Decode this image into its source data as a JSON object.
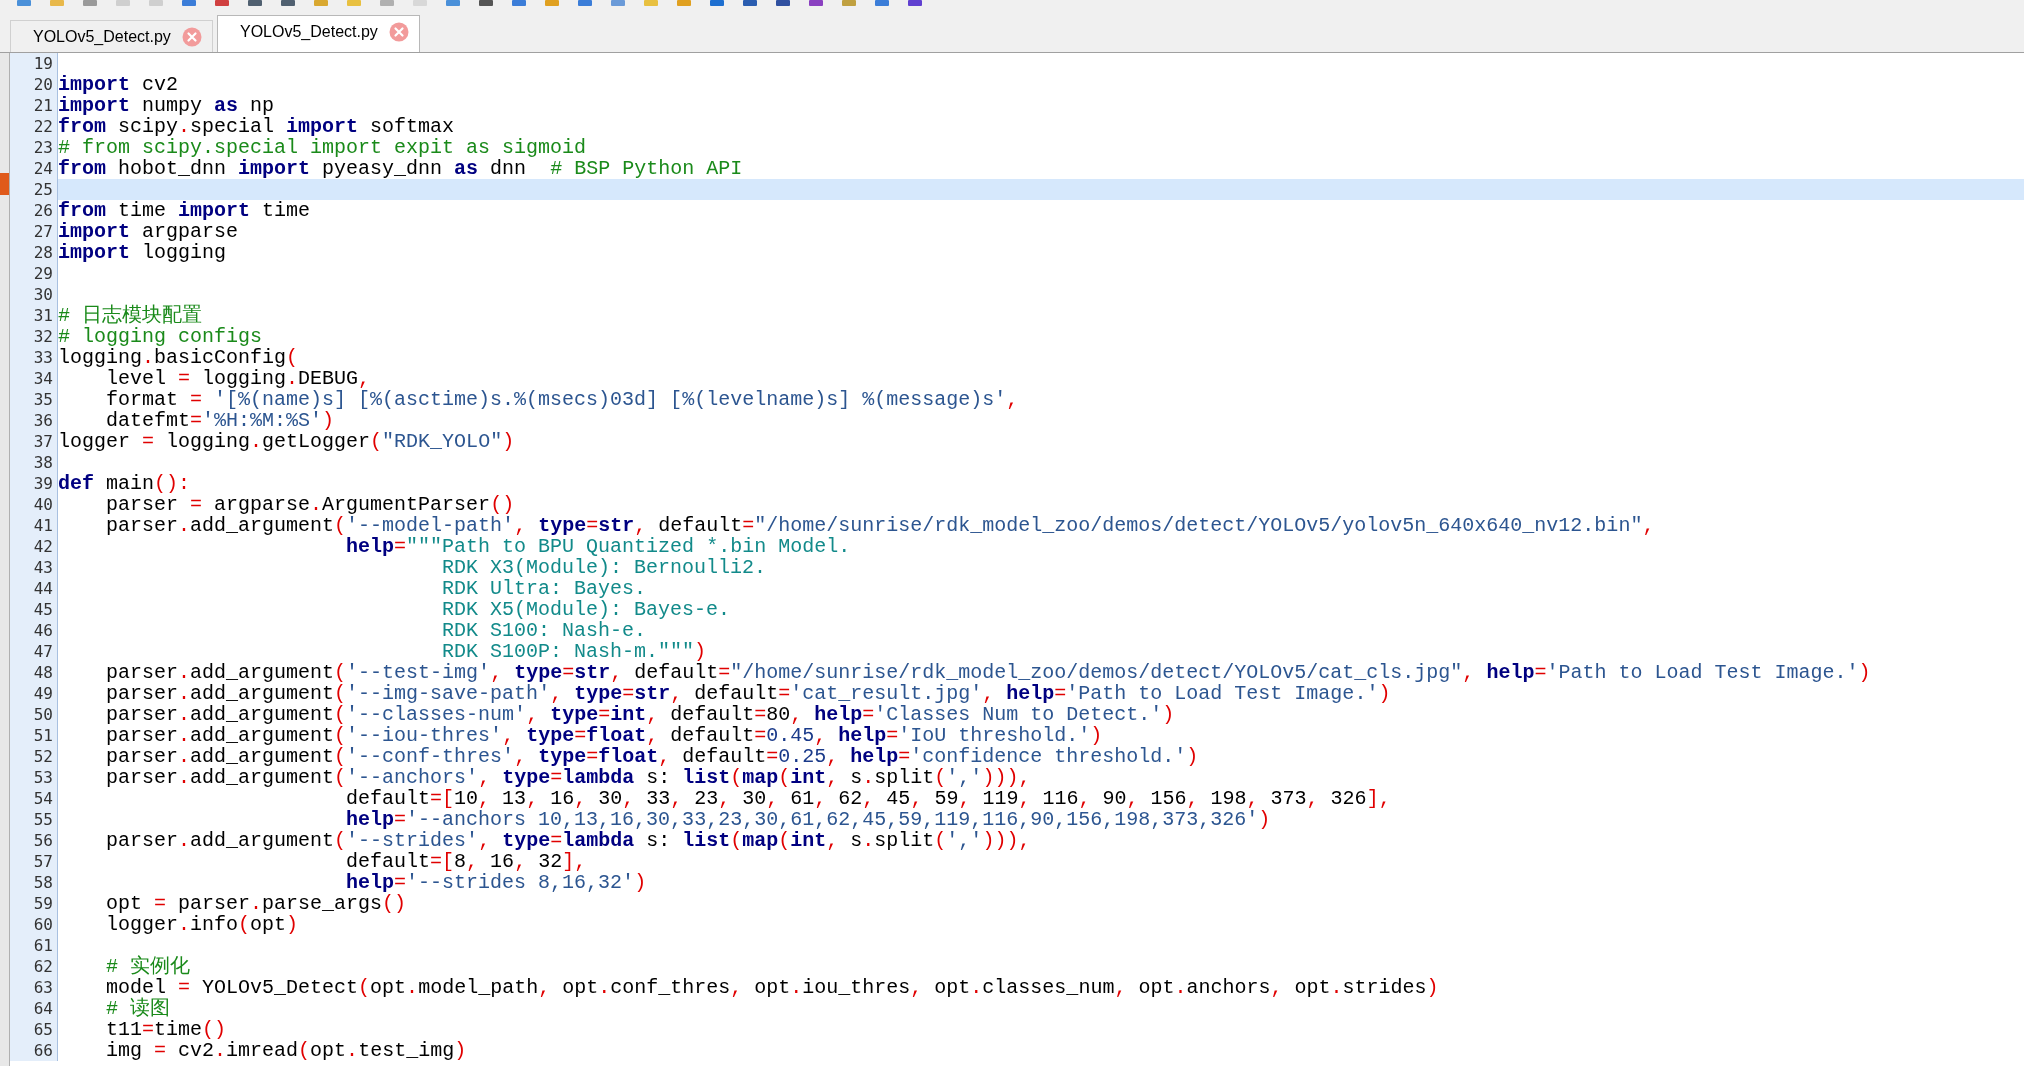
{
  "tabs": [
    {
      "label": "YOLOv5_Detect.py",
      "selected": false
    },
    {
      "label": "YOLOv5_Detect.py",
      "selected": true
    }
  ],
  "lines": [
    {
      "number": "19",
      "current": false
    },
    {
      "number": "20",
      "current": false,
      "tokens": [
        {
          "kind": "keyword",
          "text": "import"
        },
        {
          "kind": "plain",
          "text": " cv2"
        }
      ]
    },
    {
      "number": "21",
      "current": false,
      "tokens": [
        {
          "kind": "keyword",
          "text": "import"
        },
        {
          "kind": "plain",
          "text": " numpy "
        },
        {
          "kind": "keyword",
          "text": "as"
        },
        {
          "kind": "plain",
          "text": " np"
        }
      ]
    },
    {
      "number": "22",
      "current": false,
      "tokens": [
        {
          "kind": "keyword",
          "text": "from"
        },
        {
          "kind": "plain",
          "text": " scipy"
        },
        {
          "kind": "operator",
          "text": "."
        },
        {
          "kind": "plain",
          "text": "special "
        },
        {
          "kind": "keyword",
          "text": "import"
        },
        {
          "kind": "plain",
          "text": " softmax"
        }
      ]
    },
    {
      "number": "23",
      "current": false,
      "tokens": [
        {
          "kind": "comment",
          "text": "# from scipy.special import expit as sigmoid"
        }
      ]
    },
    {
      "number": "24",
      "current": false,
      "tokens": [
        {
          "kind": "keyword",
          "text": "from"
        },
        {
          "kind": "plain",
          "text": " hobot_dnn "
        },
        {
          "kind": "keyword",
          "text": "import"
        },
        {
          "kind": "plain",
          "text": " pyeasy_dnn "
        },
        {
          "kind": "keyword",
          "text": "as"
        },
        {
          "kind": "plain",
          "text": " dnn"
        },
        {
          "kind": "comment",
          "text": "  # BSP Python API"
        }
      ]
    },
    {
      "number": "25",
      "current": true
    },
    {
      "number": "26",
      "current": false,
      "tokens": [
        {
          "kind": "keyword",
          "text": "from"
        },
        {
          "kind": "plain",
          "text": " time "
        },
        {
          "kind": "keyword",
          "text": "import"
        },
        {
          "kind": "plain",
          "text": " time"
        }
      ]
    },
    {
      "number": "27",
      "current": false,
      "tokens": [
        {
          "kind": "keyword",
          "text": "import"
        },
        {
          "kind": "plain",
          "text": " argparse"
        }
      ]
    },
    {
      "number": "28",
      "current": false,
      "tokens": [
        {
          "kind": "keyword",
          "text": "import"
        },
        {
          "kind": "plain",
          "text": " logging"
        }
      ]
    },
    {
      "number": "29",
      "current": false
    },
    {
      "number": "30",
      "current": false
    },
    {
      "number": "31",
      "current": false,
      "tokens": [
        {
          "kind": "comment",
          "text": "# 日志模块配置"
        }
      ]
    },
    {
      "number": "32",
      "current": false,
      "tokens": [
        {
          "kind": "comment",
          "text": "# logging configs"
        }
      ]
    },
    {
      "number": "33",
      "current": false,
      "tokens": [
        {
          "kind": "plain",
          "text": "logging"
        },
        {
          "kind": "operator",
          "text": "."
        },
        {
          "kind": "plain",
          "text": "basicConfig"
        },
        {
          "kind": "operator",
          "text": "("
        }
      ]
    },
    {
      "number": "34",
      "current": false,
      "tokens": [
        {
          "kind": "plain",
          "text": "    level "
        },
        {
          "kind": "operator",
          "text": "="
        },
        {
          "kind": "plain",
          "text": " logging"
        },
        {
          "kind": "operator",
          "text": "."
        },
        {
          "kind": "plain",
          "text": "DEBUG"
        },
        {
          "kind": "operator",
          "text": ","
        }
      ]
    },
    {
      "number": "35",
      "current": false,
      "tokens": [
        {
          "kind": "plain",
          "text": "    format "
        },
        {
          "kind": "operator",
          "text": "="
        },
        {
          "kind": "string",
          "text": " '[%(name)s] [%(asctime)s.%(msecs)03d] [%(levelname)s] %(message)s'"
        },
        {
          "kind": "operator",
          "text": ","
        }
      ]
    },
    {
      "number": "36",
      "current": false,
      "tokens": [
        {
          "kind": "plain",
          "text": "    datefmt"
        },
        {
          "kind": "operator",
          "text": "="
        },
        {
          "kind": "string",
          "text": "'%H:%M:%S'"
        },
        {
          "kind": "operator",
          "text": ")"
        }
      ]
    },
    {
      "number": "37",
      "current": false,
      "tokens": [
        {
          "kind": "plain",
          "text": "logger "
        },
        {
          "kind": "operator",
          "text": "="
        },
        {
          "kind": "plain",
          "text": " logging"
        },
        {
          "kind": "operator",
          "text": "."
        },
        {
          "kind": "plain",
          "text": "getLogger"
        },
        {
          "kind": "operator",
          "text": "("
        },
        {
          "kind": "string",
          "text": "\"RDK_YOLO\""
        },
        {
          "kind": "operator",
          "text": ")"
        }
      ]
    },
    {
      "number": "38",
      "current": false
    },
    {
      "number": "39",
      "current": false,
      "tokens": [
        {
          "kind": "keyword",
          "text": "def"
        },
        {
          "kind": "plain",
          "text": " main"
        },
        {
          "kind": "operator",
          "text": "():"
        }
      ]
    },
    {
      "number": "40",
      "current": false,
      "tokens": [
        {
          "kind": "plain",
          "text": "    parser "
        },
        {
          "kind": "operator",
          "text": "="
        },
        {
          "kind": "plain",
          "text": " argparse"
        },
        {
          "kind": "operator",
          "text": "."
        },
        {
          "kind": "plain",
          "text": "ArgumentParser"
        },
        {
          "kind": "operator",
          "text": "()"
        }
      ]
    },
    {
      "number": "41",
      "current": false,
      "tokens": [
        {
          "kind": "plain",
          "text": "    parser"
        },
        {
          "kind": "operator",
          "text": "."
        },
        {
          "kind": "plain",
          "text": "add_argument"
        },
        {
          "kind": "operator",
          "text": "("
        },
        {
          "kind": "string",
          "text": "'--model-path'"
        },
        {
          "kind": "operator",
          "text": ","
        },
        {
          "kind": "keyword",
          "text": " type"
        },
        {
          "kind": "operator",
          "text": "="
        },
        {
          "kind": "keyword",
          "text": "str"
        },
        {
          "kind": "operator",
          "text": ","
        },
        {
          "kind": "plain",
          "text": " default"
        },
        {
          "kind": "operator",
          "text": "="
        },
        {
          "kind": "string",
          "text": "\"/home/sunrise/rdk_model_zoo/demos/detect/YOLOv5/yolov5n_640x640_nv12.bin\""
        },
        {
          "kind": "operator",
          "text": ","
        }
      ]
    },
    {
      "number": "42",
      "current": false,
      "tokens": [
        {
          "kind": "keyword",
          "text": "                        help"
        },
        {
          "kind": "operator",
          "text": "="
        },
        {
          "kind": "docstring",
          "text": "\"\"\"Path to BPU Quantized *.bin Model."
        }
      ]
    },
    {
      "number": "43",
      "current": false,
      "tokens": [
        {
          "kind": "docstring",
          "text": "                                RDK X3(Module): Bernoulli2."
        }
      ]
    },
    {
      "number": "44",
      "current": false,
      "tokens": [
        {
          "kind": "docstring",
          "text": "                                RDK Ultra: Bayes."
        }
      ]
    },
    {
      "number": "45",
      "current": false,
      "tokens": [
        {
          "kind": "docstring",
          "text": "                                RDK X5(Module): Bayes-e."
        }
      ]
    },
    {
      "number": "46",
      "current": false,
      "tokens": [
        {
          "kind": "docstring",
          "text": "                                RDK S100: Nash-e."
        }
      ]
    },
    {
      "number": "47",
      "current": false,
      "tokens": [
        {
          "kind": "docstring",
          "text": "                                RDK S100P: Nash-m.\"\"\""
        },
        {
          "kind": "operator",
          "text": ")"
        }
      ]
    },
    {
      "number": "48",
      "current": false,
      "tokens": [
        {
          "kind": "plain",
          "text": "    parser"
        },
        {
          "kind": "operator",
          "text": "."
        },
        {
          "kind": "plain",
          "text": "add_argument"
        },
        {
          "kind": "operator",
          "text": "("
        },
        {
          "kind": "string",
          "text": "'--test-img'"
        },
        {
          "kind": "operator",
          "text": ","
        },
        {
          "kind": "keyword",
          "text": " type"
        },
        {
          "kind": "operator",
          "text": "="
        },
        {
          "kind": "keyword",
          "text": "str"
        },
        {
          "kind": "operator",
          "text": ","
        },
        {
          "kind": "plain",
          "text": " default"
        },
        {
          "kind": "operator",
          "text": "="
        },
        {
          "kind": "string",
          "text": "\"/home/sunrise/rdk_model_zoo/demos/detect/YOLOv5/cat_cls.jpg\""
        },
        {
          "kind": "operator",
          "text": ","
        },
        {
          "kind": "keyword",
          "text": " help"
        },
        {
          "kind": "operator",
          "text": "="
        },
        {
          "kind": "string",
          "text": "'Path to Load Test Image.'"
        },
        {
          "kind": "operator",
          "text": ")"
        }
      ]
    },
    {
      "number": "49",
      "current": false,
      "tokens": [
        {
          "kind": "plain",
          "text": "    parser"
        },
        {
          "kind": "operator",
          "text": "."
        },
        {
          "kind": "plain",
          "text": "add_argument"
        },
        {
          "kind": "operator",
          "text": "("
        },
        {
          "kind": "string",
          "text": "'--img-save-path'"
        },
        {
          "kind": "operator",
          "text": ","
        },
        {
          "kind": "keyword",
          "text": " type"
        },
        {
          "kind": "operator",
          "text": "="
        },
        {
          "kind": "keyword",
          "text": "str"
        },
        {
          "kind": "operator",
          "text": ","
        },
        {
          "kind": "plain",
          "text": " default"
        },
        {
          "kind": "operator",
          "text": "="
        },
        {
          "kind": "string",
          "text": "'cat_result.jpg'"
        },
        {
          "kind": "operator",
          "text": ","
        },
        {
          "kind": "keyword",
          "text": " help"
        },
        {
          "kind": "operator",
          "text": "="
        },
        {
          "kind": "string",
          "text": "'Path to Load Test Image.'"
        },
        {
          "kind": "operator",
          "text": ")"
        }
      ]
    },
    {
      "number": "50",
      "current": false,
      "tokens": [
        {
          "kind": "plain",
          "text": "    parser"
        },
        {
          "kind": "operator",
          "text": "."
        },
        {
          "kind": "plain",
          "text": "add_argument"
        },
        {
          "kind": "operator",
          "text": "("
        },
        {
          "kind": "string",
          "text": "'--classes-num'"
        },
        {
          "kind": "operator",
          "text": ","
        },
        {
          "kind": "keyword",
          "text": " type"
        },
        {
          "kind": "operator",
          "text": "="
        },
        {
          "kind": "keyword",
          "text": "int"
        },
        {
          "kind": "operator",
          "text": ","
        },
        {
          "kind": "plain",
          "text": " default"
        },
        {
          "kind": "operator",
          "text": "="
        },
        {
          "kind": "plain",
          "text": "80"
        },
        {
          "kind": "operator",
          "text": ","
        },
        {
          "kind": "keyword",
          "text": " help"
        },
        {
          "kind": "operator",
          "text": "="
        },
        {
          "kind": "string",
          "text": "'Classes Num to Detect.'"
        },
        {
          "kind": "operator",
          "text": ")"
        }
      ]
    },
    {
      "number": "51",
      "current": false,
      "tokens": [
        {
          "kind": "plain",
          "text": "    parser"
        },
        {
          "kind": "operator",
          "text": "."
        },
        {
          "kind": "plain",
          "text": "add_argument"
        },
        {
          "kind": "operator",
          "text": "("
        },
        {
          "kind": "string",
          "text": "'--iou-thres'"
        },
        {
          "kind": "operator",
          "text": ","
        },
        {
          "kind": "keyword",
          "text": " type"
        },
        {
          "kind": "operator",
          "text": "="
        },
        {
          "kind": "keyword",
          "text": "float"
        },
        {
          "kind": "operator",
          "text": ","
        },
        {
          "kind": "plain",
          "text": " default"
        },
        {
          "kind": "operator",
          "text": "="
        },
        {
          "kind": "number",
          "text": "0.45"
        },
        {
          "kind": "operator",
          "text": ","
        },
        {
          "kind": "keyword",
          "text": " help"
        },
        {
          "kind": "operator",
          "text": "="
        },
        {
          "kind": "string",
          "text": "'IoU threshold.'"
        },
        {
          "kind": "operator",
          "text": ")"
        }
      ]
    },
    {
      "number": "52",
      "current": false,
      "tokens": [
        {
          "kind": "plain",
          "text": "    parser"
        },
        {
          "kind": "operator",
          "text": "."
        },
        {
          "kind": "plain",
          "text": "add_argument"
        },
        {
          "kind": "operator",
          "text": "("
        },
        {
          "kind": "string",
          "text": "'--conf-thres'"
        },
        {
          "kind": "operator",
          "text": ","
        },
        {
          "kind": "keyword",
          "text": " type"
        },
        {
          "kind": "operator",
          "text": "="
        },
        {
          "kind": "keyword",
          "text": "float"
        },
        {
          "kind": "operator",
          "text": ","
        },
        {
          "kind": "plain",
          "text": " default"
        },
        {
          "kind": "operator",
          "text": "="
        },
        {
          "kind": "number",
          "text": "0.25"
        },
        {
          "kind": "operator",
          "text": ","
        },
        {
          "kind": "keyword",
          "text": " help"
        },
        {
          "kind": "operator",
          "text": "="
        },
        {
          "kind": "string",
          "text": "'confidence threshold.'"
        },
        {
          "kind": "operator",
          "text": ")"
        }
      ]
    },
    {
      "number": "53",
      "current": false,
      "tokens": [
        {
          "kind": "plain",
          "text": "    parser"
        },
        {
          "kind": "operator",
          "text": "."
        },
        {
          "kind": "plain",
          "text": "add_argument"
        },
        {
          "kind": "operator",
          "text": "("
        },
        {
          "kind": "string",
          "text": "'--anchors'"
        },
        {
          "kind": "operator",
          "text": ","
        },
        {
          "kind": "keyword",
          "text": " type"
        },
        {
          "kind": "operator",
          "text": "="
        },
        {
          "kind": "keyword",
          "text": "lambda"
        },
        {
          "kind": "plain",
          "text": " s:"
        },
        {
          "kind": "keyword",
          "text": " list"
        },
        {
          "kind": "operator",
          "text": "("
        },
        {
          "kind": "keyword",
          "text": "map"
        },
        {
          "kind": "operator",
          "text": "("
        },
        {
          "kind": "keyword",
          "text": "int"
        },
        {
          "kind": "operator",
          "text": ","
        },
        {
          "kind": "plain",
          "text": " s"
        },
        {
          "kind": "operator",
          "text": "."
        },
        {
          "kind": "plain",
          "text": "split"
        },
        {
          "kind": "operator",
          "text": "("
        },
        {
          "kind": "string",
          "text": "','"
        },
        {
          "kind": "operator",
          "text": "))),"
        }
      ]
    },
    {
      "number": "54",
      "current": false,
      "tokens": [
        {
          "kind": "plain",
          "text": "                        default"
        },
        {
          "kind": "operator",
          "text": "=["
        },
        {
          "kind": "plain",
          "text": "10"
        },
        {
          "kind": "operator",
          "text": ","
        },
        {
          "kind": "plain",
          "text": " 13"
        },
        {
          "kind": "operator",
          "text": ","
        },
        {
          "kind": "plain",
          "text": " 16"
        },
        {
          "kind": "operator",
          "text": ","
        },
        {
          "kind": "plain",
          "text": " 30"
        },
        {
          "kind": "operator",
          "text": ","
        },
        {
          "kind": "plain",
          "text": " 33"
        },
        {
          "kind": "operator",
          "text": ","
        },
        {
          "kind": "plain",
          "text": " 23"
        },
        {
          "kind": "operator",
          "text": ","
        },
        {
          "kind": "plain",
          "text": " 30"
        },
        {
          "kind": "operator",
          "text": ","
        },
        {
          "kind": "plain",
          "text": " 61"
        },
        {
          "kind": "operator",
          "text": ","
        },
        {
          "kind": "plain",
          "text": " 62"
        },
        {
          "kind": "operator",
          "text": ","
        },
        {
          "kind": "plain",
          "text": " 45"
        },
        {
          "kind": "operator",
          "text": ","
        },
        {
          "kind": "plain",
          "text": " 59"
        },
        {
          "kind": "operator",
          "text": ","
        },
        {
          "kind": "plain",
          "text": " 119"
        },
        {
          "kind": "operator",
          "text": ","
        },
        {
          "kind": "plain",
          "text": " 116"
        },
        {
          "kind": "operator",
          "text": ","
        },
        {
          "kind": "plain",
          "text": " 90"
        },
        {
          "kind": "operator",
          "text": ","
        },
        {
          "kind": "plain",
          "text": " 156"
        },
        {
          "kind": "operator",
          "text": ","
        },
        {
          "kind": "plain",
          "text": " 198"
        },
        {
          "kind": "operator",
          "text": ","
        },
        {
          "kind": "plain",
          "text": " 373"
        },
        {
          "kind": "operator",
          "text": ","
        },
        {
          "kind": "plain",
          "text": " 326"
        },
        {
          "kind": "operator",
          "text": "],"
        }
      ]
    },
    {
      "number": "55",
      "current": false,
      "tokens": [
        {
          "kind": "keyword",
          "text": "                        help"
        },
        {
          "kind": "operator",
          "text": "="
        },
        {
          "kind": "string",
          "text": "'--anchors 10,13,16,30,33,23,30,61,62,45,59,119,116,90,156,198,373,326'"
        },
        {
          "kind": "operator",
          "text": ")"
        }
      ]
    },
    {
      "number": "56",
      "current": false,
      "tokens": [
        {
          "kind": "plain",
          "text": "    parser"
        },
        {
          "kind": "operator",
          "text": "."
        },
        {
          "kind": "plain",
          "text": "add_argument"
        },
        {
          "kind": "operator",
          "text": "("
        },
        {
          "kind": "string",
          "text": "'--strides'"
        },
        {
          "kind": "operator",
          "text": ","
        },
        {
          "kind": "keyword",
          "text": " type"
        },
        {
          "kind": "operator",
          "text": "="
        },
        {
          "kind": "keyword",
          "text": "lambda"
        },
        {
          "kind": "plain",
          "text": " s:"
        },
        {
          "kind": "keyword",
          "text": " list"
        },
        {
          "kind": "operator",
          "text": "("
        },
        {
          "kind": "keyword",
          "text": "map"
        },
        {
          "kind": "operator",
          "text": "("
        },
        {
          "kind": "keyword",
          "text": "int"
        },
        {
          "kind": "operator",
          "text": ","
        },
        {
          "kind": "plain",
          "text": " s"
        },
        {
          "kind": "operator",
          "text": "."
        },
        {
          "kind": "plain",
          "text": "split"
        },
        {
          "kind": "operator",
          "text": "("
        },
        {
          "kind": "string",
          "text": "','"
        },
        {
          "kind": "operator",
          "text": "))),"
        }
      ]
    },
    {
      "number": "57",
      "current": false,
      "tokens": [
        {
          "kind": "plain",
          "text": "                        default"
        },
        {
          "kind": "operator",
          "text": "=["
        },
        {
          "kind": "plain",
          "text": "8"
        },
        {
          "kind": "operator",
          "text": ","
        },
        {
          "kind": "plain",
          "text": " 16"
        },
        {
          "kind": "operator",
          "text": ","
        },
        {
          "kind": "plain",
          "text": " 32"
        },
        {
          "kind": "operator",
          "text": "],"
        }
      ]
    },
    {
      "number": "58",
      "current": false,
      "tokens": [
        {
          "kind": "keyword",
          "text": "                        help"
        },
        {
          "kind": "operator",
          "text": "="
        },
        {
          "kind": "string",
          "text": "'--strides 8,16,32'"
        },
        {
          "kind": "operator",
          "text": ")"
        }
      ]
    },
    {
      "number": "59",
      "current": false,
      "tokens": [
        {
          "kind": "plain",
          "text": "    opt "
        },
        {
          "kind": "operator",
          "text": "="
        },
        {
          "kind": "plain",
          "text": " parser"
        },
        {
          "kind": "operator",
          "text": "."
        },
        {
          "kind": "plain",
          "text": "parse_args"
        },
        {
          "kind": "operator",
          "text": "()"
        }
      ]
    },
    {
      "number": "60",
      "current": false,
      "tokens": [
        {
          "kind": "plain",
          "text": "    logger"
        },
        {
          "kind": "operator",
          "text": "."
        },
        {
          "kind": "plain",
          "text": "info"
        },
        {
          "kind": "operator",
          "text": "("
        },
        {
          "kind": "plain",
          "text": "opt"
        },
        {
          "kind": "operator",
          "text": ")"
        }
      ]
    },
    {
      "number": "61",
      "current": false
    },
    {
      "number": "62",
      "current": false,
      "tokens": [
        {
          "kind": "comment",
          "text": "    # 实例化"
        }
      ]
    },
    {
      "number": "63",
      "current": false,
      "tokens": [
        {
          "kind": "plain",
          "text": "    model "
        },
        {
          "kind": "operator",
          "text": "="
        },
        {
          "kind": "plain",
          "text": " YOLOv5_Detect"
        },
        {
          "kind": "operator",
          "text": "("
        },
        {
          "kind": "plain",
          "text": "opt"
        },
        {
          "kind": "operator",
          "text": "."
        },
        {
          "kind": "plain",
          "text": "model_path"
        },
        {
          "kind": "operator",
          "text": ","
        },
        {
          "kind": "plain",
          "text": " opt"
        },
        {
          "kind": "operator",
          "text": "."
        },
        {
          "kind": "plain",
          "text": "conf_thres"
        },
        {
          "kind": "operator",
          "text": ","
        },
        {
          "kind": "plain",
          "text": " opt"
        },
        {
          "kind": "operator",
          "text": "."
        },
        {
          "kind": "plain",
          "text": "iou_thres"
        },
        {
          "kind": "operator",
          "text": ","
        },
        {
          "kind": "plain",
          "text": " opt"
        },
        {
          "kind": "operator",
          "text": "."
        },
        {
          "kind": "plain",
          "text": "classes_num"
        },
        {
          "kind": "operator",
          "text": ","
        },
        {
          "kind": "plain",
          "text": " opt"
        },
        {
          "kind": "operator",
          "text": "."
        },
        {
          "kind": "plain",
          "text": "anchors"
        },
        {
          "kind": "operator",
          "text": ","
        },
        {
          "kind": "plain",
          "text": " opt"
        },
        {
          "kind": "operator",
          "text": "."
        },
        {
          "kind": "plain",
          "text": "strides"
        },
        {
          "kind": "operator",
          "text": ")"
        }
      ]
    },
    {
      "number": "64",
      "current": false,
      "tokens": [
        {
          "kind": "comment",
          "text": "    # 读图"
        }
      ]
    },
    {
      "number": "65",
      "current": false,
      "tokens": [
        {
          "kind": "plain",
          "text": "    t11"
        },
        {
          "kind": "operator",
          "text": "="
        },
        {
          "kind": "plain",
          "text": "time"
        },
        {
          "kind": "operator",
          "text": "()"
        }
      ]
    },
    {
      "number": "66",
      "current": false,
      "tokens": [
        {
          "kind": "plain",
          "text": "    img "
        },
        {
          "kind": "operator",
          "text": "="
        },
        {
          "kind": "plain",
          "text": " cv2"
        },
        {
          "kind": "operator",
          "text": "."
        },
        {
          "kind": "plain",
          "text": "imread"
        },
        {
          "kind": "operator",
          "text": "("
        },
        {
          "kind": "plain",
          "text": "opt"
        },
        {
          "kind": "operator",
          "text": "."
        },
        {
          "kind": "plain",
          "text": "test_img"
        },
        {
          "kind": "operator",
          "text": ")"
        }
      ]
    }
  ]
}
